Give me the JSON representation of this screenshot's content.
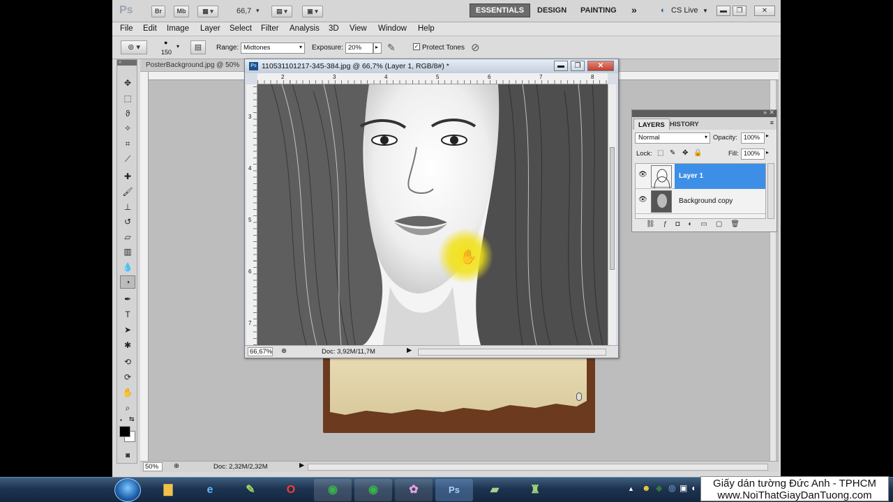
{
  "appbar": {
    "logo": "Ps",
    "bridge_label": "Br",
    "minibridge_label": "Mb",
    "zoom_value": "66,7",
    "workspaces": [
      "ESSENTIALS",
      "DESIGN",
      "PAINTING"
    ],
    "more_glyph": "»",
    "cslive_label": "CS Live"
  },
  "menubar": [
    "File",
    "Edit",
    "Image",
    "Layer",
    "Select",
    "Filter",
    "Analysis",
    "3D",
    "View",
    "Window",
    "Help"
  ],
  "options": {
    "brush_size": "150",
    "range_label": "Range:",
    "range_value": "Midtones",
    "exposure_label": "Exposure:",
    "exposure_value": "20%",
    "protect_tones_label": "Protect Tones"
  },
  "background_doc": {
    "tab_title": "PosterBackground.jpg @ 50%",
    "status_zoom": "50%",
    "status_doc": "Doc: 2,32M/2,32M"
  },
  "active_doc": {
    "title": "110531101217-345-384.jpg @ 66,7% (Layer 1, RGB/8#) *",
    "status_zoom": "66,67%",
    "status_doc": "Doc: 3,92M/11,7M",
    "ruler_h": [
      "2",
      "3",
      "4",
      "5",
      "6",
      "7",
      "8"
    ],
    "ruler_v": [
      "3",
      "4",
      "5",
      "6",
      "7"
    ]
  },
  "layers_panel": {
    "tabs": [
      "LAYERS",
      "HISTORY"
    ],
    "blend_mode": "Normal",
    "opacity_label": "Opacity:",
    "opacity_value": "100%",
    "lock_label": "Lock:",
    "fill_label": "Fill:",
    "fill_value": "100%",
    "layers": [
      {
        "name": "Layer 1",
        "selected": true
      },
      {
        "name": "Background copy",
        "selected": false
      }
    ]
  },
  "watermark": {
    "line1": "Giấy dán tường Đức Anh - TPHCM",
    "line2": "www.NoiThatGiayDanTuong.com"
  },
  "colors": {
    "selection_blue": "#3d8ee6",
    "highlight_yellow": "#f2e21a",
    "taskbar": "#1d3350"
  }
}
